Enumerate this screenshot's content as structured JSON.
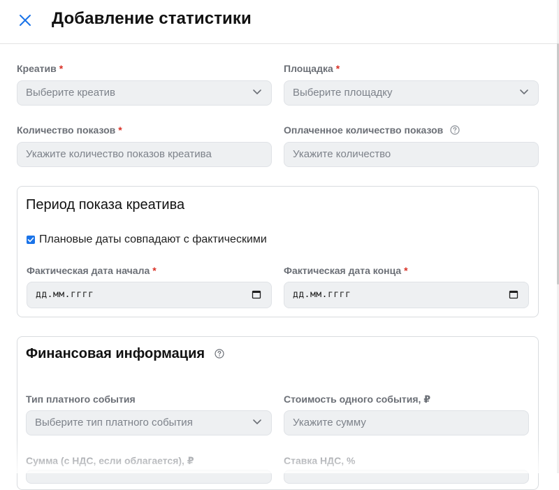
{
  "header": {
    "title": "Добавление статистики",
    "close_icon": "close-icon"
  },
  "colors": {
    "accent": "#1a73e8",
    "required": "#d93025",
    "field_bg": "#eef0f2"
  },
  "form": {
    "creative": {
      "label": "Креатив",
      "required": "*",
      "placeholder": "Выберите креатив"
    },
    "platform": {
      "label": "Площадка",
      "required": "*",
      "placeholder": "Выберите площадку"
    },
    "impressions": {
      "label": "Количество показов",
      "required": "*",
      "placeholder": "Укажите количество показов креатива"
    },
    "paid_impressions": {
      "label": "Оплаченное количество показов",
      "placeholder": "Укажите количество"
    }
  },
  "period": {
    "title": "Период показа креатива",
    "checkbox_label": "Плановые даты совпадают с фактическими",
    "checkbox_checked": true,
    "start": {
      "label": "Фактическая дата начала",
      "required": "*",
      "value": "дд.мм.гггг"
    },
    "end": {
      "label": "Фактическая дата конца",
      "required": "*",
      "value": "дд.мм.гггг"
    }
  },
  "finance": {
    "title": "Финансовая информация",
    "event_type": {
      "label": "Тип платного события",
      "placeholder": "Выберите тип платного события"
    },
    "event_cost": {
      "label": "Стоимость одного события, ₽",
      "placeholder": "Укажите сумму"
    },
    "sum_label": "Сумма (с НДС, если облагается), ₽",
    "vat_label": "Ставка НДС, %"
  }
}
